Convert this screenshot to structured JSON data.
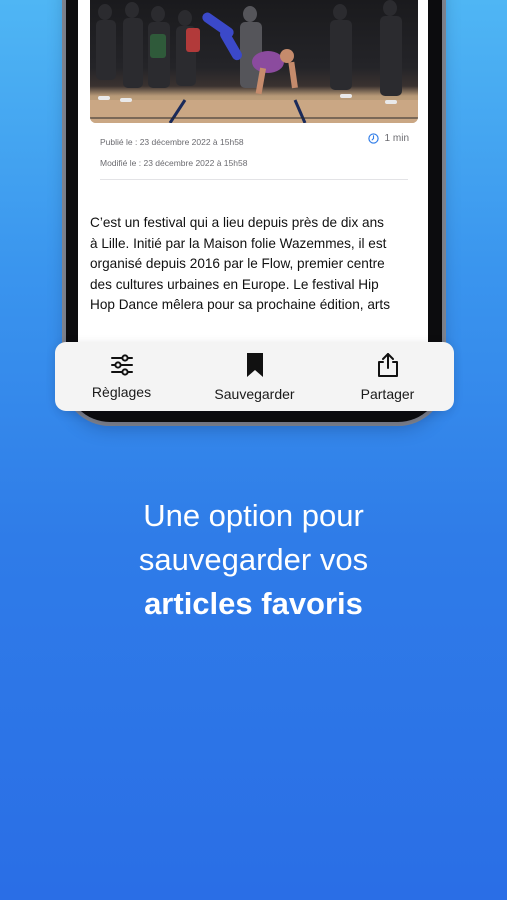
{
  "article": {
    "published": "Publié le : 23 décembre 2022 à 15h58",
    "modified": "Modifié le : 23 décembre 2022 à 15h58",
    "read_time": "1 min",
    "read_time_icon": "clock-icon",
    "body_lines": [
      "C’est un festival qui a lieu depuis près de dix ans",
      "à Lille. Initié par la Maison folie Wazemmes, il est",
      "organisé depuis 2016 par le Flow, premier centre",
      "des cultures urbaines en Europe. Le festival Hip",
      "Hop Dance mêlera pour sa prochaine édition, arts"
    ]
  },
  "toolbar": {
    "settings_label": "Règlages",
    "settings_icon": "sliders-icon",
    "save_label": "Sauvegarder",
    "save_icon": "bookmark-icon",
    "share_label": "Partager",
    "share_icon": "share-icon"
  },
  "tagline": {
    "line1": "Une option pour",
    "line2": "sauvegarder vos",
    "line3": "articles favoris"
  },
  "colors": {
    "background_top": "#4fb6f4",
    "background_bottom": "#2a6ee6",
    "toolbar_bg": "#f4f4f4",
    "accent": "#2f7ce8"
  }
}
